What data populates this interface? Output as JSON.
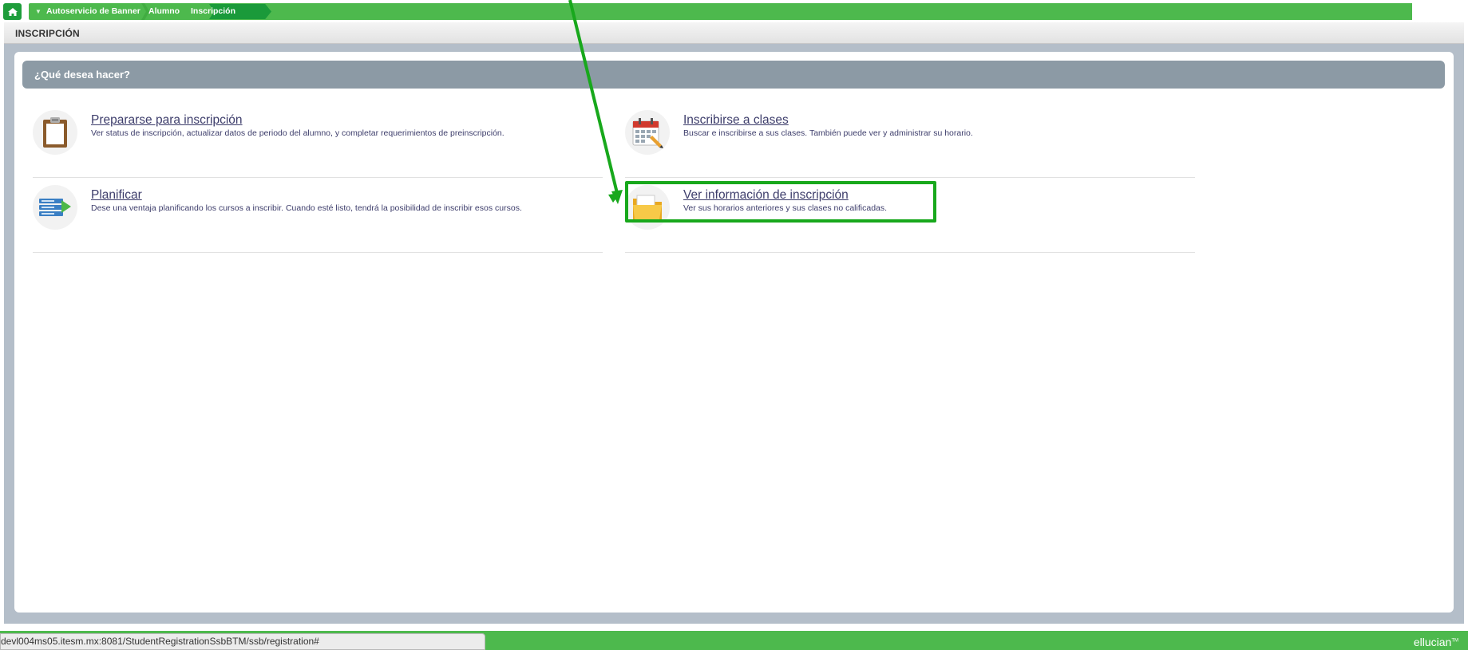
{
  "breadcrumb": {
    "items": [
      "Autoservicio de Banner",
      "Alumno",
      "Inscripción"
    ]
  },
  "page_title": "INSCRIPCIÓN",
  "question": "¿Qué desea hacer?",
  "options": [
    {
      "title": "Prepararse para inscripción",
      "description": "Ver status de inscripción, actualizar datos de periodo del alumno, y completar requerimientos de preinscripción.",
      "icon": "clipboard-icon"
    },
    {
      "title": "Inscribirse a clases",
      "description": "Buscar e inscribirse a sus clases. También puede ver y administrar su horario.",
      "icon": "calendar-icon"
    },
    {
      "title": "Planificar",
      "description": "Dese una ventaja planificando los cursos a inscribir. Cuando esté listo, tendrá la posibilidad de inscribir esos cursos.",
      "icon": "plan-list-icon"
    },
    {
      "title": "Ver información de inscripción",
      "description": "Ver sus horarios anteriores y sus clases no calificadas.",
      "icon": "folder-icon"
    }
  ],
  "status_url": "devl004ms05.itesm.mx:8081/StudentRegistrationSsbBTM/ssb/registration#",
  "brand": "ellucian",
  "brand_mark": "TM",
  "colors": {
    "accent_green": "#4db94d",
    "dark_green": "#1a9a3a",
    "header_gray": "#8c9aa5",
    "highlight_green": "#18a81c",
    "link_color": "#3d3d6b"
  }
}
